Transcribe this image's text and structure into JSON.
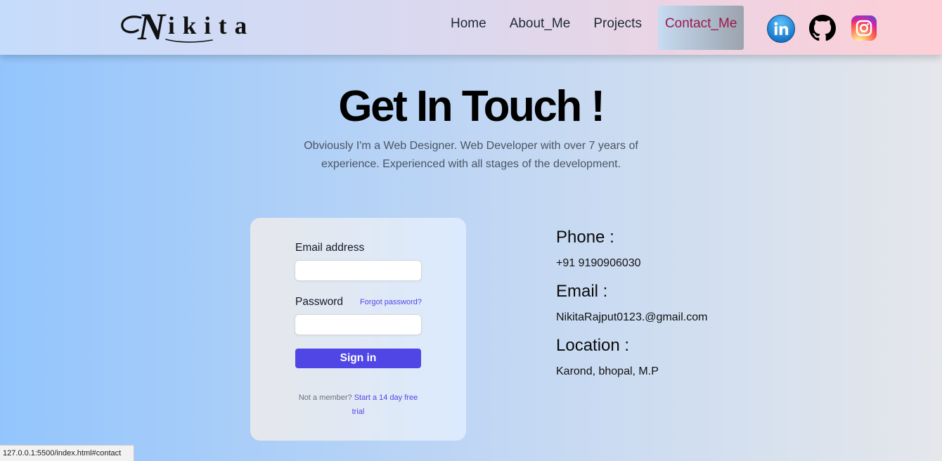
{
  "header": {
    "logo": "Nikita",
    "nav": [
      {
        "label": "Home",
        "active": false
      },
      {
        "label": "About_Me",
        "active": false
      },
      {
        "label": "Projects",
        "active": false
      },
      {
        "label": "Contact_Me",
        "active": true
      }
    ],
    "social_icons": [
      "linkedin-icon",
      "github-icon",
      "instagram-icon"
    ]
  },
  "hero": {
    "title": "Get In Touch !",
    "subtitle": "Obviously I'm a Web Designer. Web Developer with over 7 years of experience. Experienced with all stages of the development."
  },
  "login_form": {
    "email_label": "Email address",
    "password_label": "Password",
    "forgot_password_link": "Forgot password?",
    "submit_label": "Sign in",
    "signup_prompt": "Not a member?",
    "signup_link": "Start a 14 day free trial"
  },
  "contact_info": [
    {
      "heading": "Phone :",
      "value": "+91 9190906030"
    },
    {
      "heading": "Email :",
      "value": "NikitaRajput0123.@gmail.com"
    },
    {
      "heading": "Location :",
      "value": "Karond, bhopal, M.P"
    }
  ],
  "status_bar": {
    "url": "127.0.0.1:5500/index.html#contact"
  },
  "colors": {
    "accent": "#4f46e5",
    "active_nav": "#9d174d"
  }
}
